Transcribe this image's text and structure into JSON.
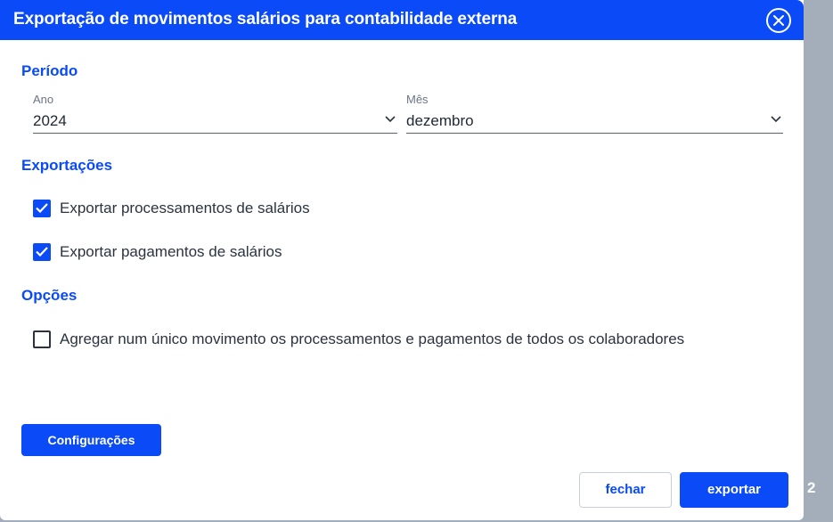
{
  "dialog": {
    "title": "Exportação de movimentos salários para contabilidade externa",
    "close_icon": "close-circle-icon"
  },
  "periodo": {
    "section_title": "Período",
    "ano": {
      "label": "Ano",
      "value": "2024"
    },
    "mes": {
      "label": "Mês",
      "value": "dezembro"
    }
  },
  "exportacoes": {
    "section_title": "Exportações",
    "items": [
      {
        "label": "Exportar processamentos de salários",
        "checked": true
      },
      {
        "label": "Exportar pagamentos de salários",
        "checked": true
      }
    ]
  },
  "opcoes": {
    "section_title": "Opções",
    "items": [
      {
        "label": "Agregar num único movimento os processamentos e pagamentos de todos os colaboradores",
        "checked": false
      }
    ]
  },
  "buttons": {
    "configuracoes": "Configurações",
    "fechar": "fechar",
    "exportar": "exportar"
  },
  "backdrop": {
    "number": "2"
  },
  "colors": {
    "accent": "#0a4af7",
    "backdrop": "#a4aebb",
    "text": "#2b3340"
  }
}
